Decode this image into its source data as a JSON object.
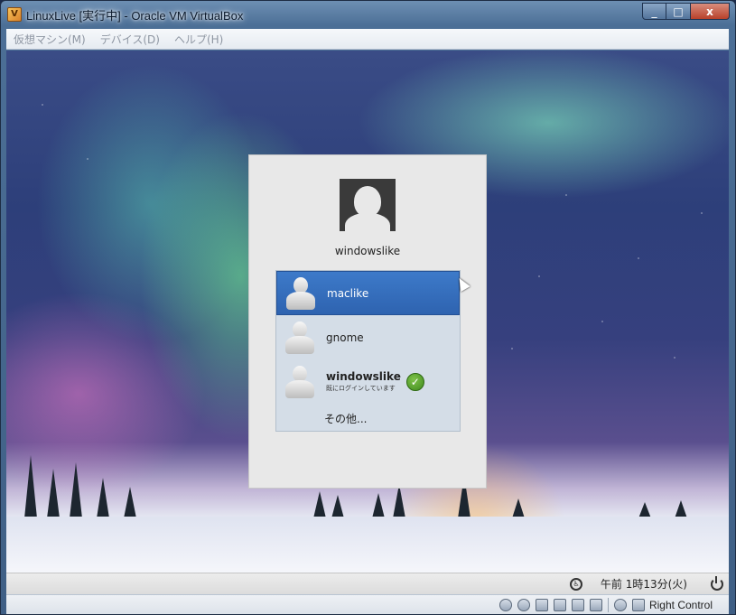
{
  "window": {
    "title": "LinuxLive [実行中] - Oracle VM VirtualBox",
    "app_icon": "virtualbox-icon",
    "controls": {
      "minimize": "_",
      "maximize": "□",
      "close": "x"
    }
  },
  "menubar": {
    "items": [
      {
        "label": "仮想マシン(M)"
      },
      {
        "label": "デバイス(D)"
      },
      {
        "label": "ヘルプ(H)"
      }
    ]
  },
  "login": {
    "current_user": "windowslike",
    "users": [
      {
        "name": "maclike",
        "selected": true
      },
      {
        "name": "gnome",
        "selected": false
      },
      {
        "name": "windowslike",
        "status": "既にログインしています",
        "logged_in": true
      }
    ],
    "other_label": "その他..."
  },
  "guest_panel": {
    "clock": "午前 1時13分(火)",
    "icons": [
      "accessibility-icon",
      "power-icon"
    ]
  },
  "statusbar": {
    "icons": [
      "hard-disk-icon",
      "optical-drive-icon",
      "network-icon",
      "usb-icon",
      "shared-folders-icon",
      "display-icon",
      "virtualization-icon",
      "mouse-integration-icon"
    ],
    "host_key": "Right Control"
  },
  "colors": {
    "selection": "#3d7ac9",
    "dialog_bg": "#e8e8e8",
    "check": "#4f9d26"
  }
}
